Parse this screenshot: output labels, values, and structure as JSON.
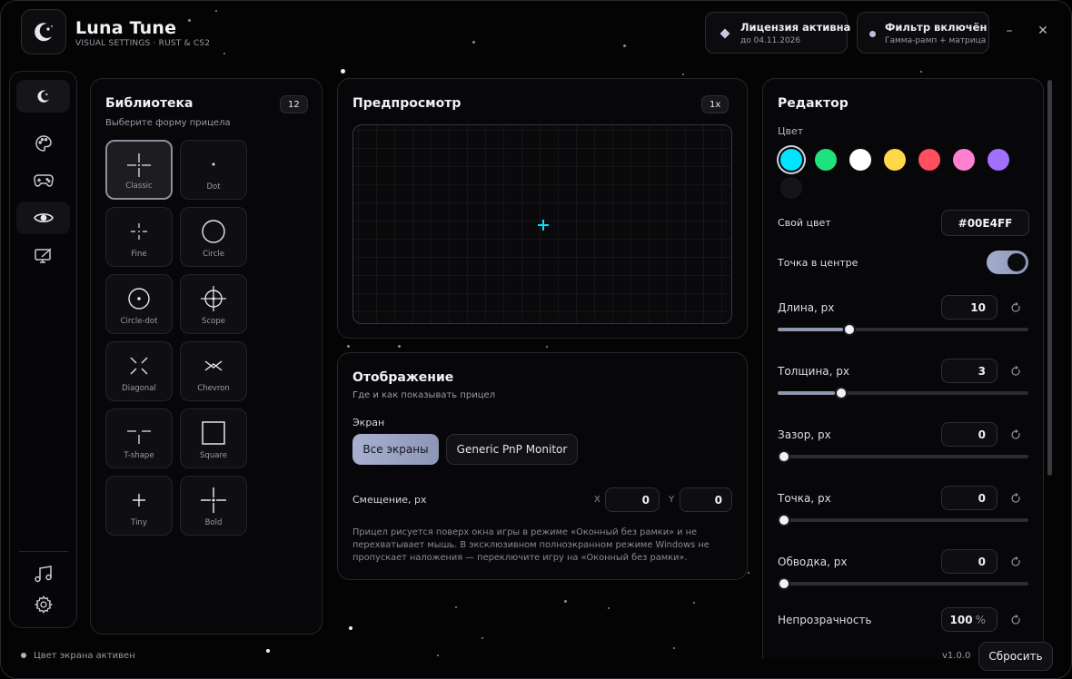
{
  "app": {
    "title": "Luna Tune",
    "subtitle": "VISUAL SETTINGS · RUST & CS2",
    "logo_icon": "moon-star-icon"
  },
  "header": {
    "license": {
      "title": "Лицензия активна",
      "subtitle": "до 04.11.2026",
      "icon": "diamond-icon"
    },
    "filter": {
      "title": "Фильтр включён",
      "subtitle": "Гамма-рамп + матрица",
      "icon": "dot-icon"
    },
    "minimize_label": "–",
    "close_label": "✕"
  },
  "sidebar": {
    "items": [
      {
        "name": "home",
        "icon": "moon-star-icon",
        "active": false
      },
      {
        "name": "palette",
        "icon": "palette-icon",
        "active": false
      },
      {
        "name": "gamepad",
        "icon": "gamepad-icon",
        "active": false
      },
      {
        "name": "eye",
        "icon": "eye-icon",
        "active": true
      },
      {
        "name": "display",
        "icon": "monitor-icon",
        "active": false
      },
      {
        "name": "music",
        "icon": "music-icon",
        "active": false
      },
      {
        "name": "settings",
        "icon": "gear-icon",
        "active": false
      }
    ]
  },
  "library": {
    "title": "Библиотека",
    "subtitle": "Выберите форму прицела",
    "count": "12",
    "items": [
      {
        "label": "Classic",
        "selected": true
      },
      {
        "label": "Dot",
        "selected": false
      },
      {
        "label": "Fine",
        "selected": false
      },
      {
        "label": "Circle",
        "selected": false
      },
      {
        "label": "Circle-dot",
        "selected": false
      },
      {
        "label": "Scope",
        "selected": false
      },
      {
        "label": "Diagonal",
        "selected": false
      },
      {
        "label": "Chevron",
        "selected": false
      },
      {
        "label": "T-shape",
        "selected": false
      },
      {
        "label": "Square",
        "selected": false
      },
      {
        "label": "Tiny",
        "selected": false
      },
      {
        "label": "Bold",
        "selected": false
      }
    ]
  },
  "preview": {
    "title": "Предпросмотр",
    "zoom": "1x",
    "crosshair_color": "#00E4FF"
  },
  "display": {
    "title": "Отображение",
    "subtitle": "Где и как показывать прицел",
    "screen_label": "Экран",
    "screens": [
      "Все экраны",
      "Generic PnP Monitor"
    ],
    "offset_label": "Смещение, px",
    "x_label": "X",
    "x_value": "0",
    "y_label": "Y",
    "y_value": "0",
    "note": "Прицел рисуется поверх окна игры в режиме «Оконный без рамки» и не перехватывает мышь. В эксклюзивном полноэкранном режиме Windows не пропускает наложения — переключите игру на «Оконный без рамки»."
  },
  "editor": {
    "title": "Редактор",
    "color_label": "Цвет",
    "colors": [
      "#00E4FF",
      "#1FE27E",
      "#FFFFFF",
      "#FFD84A",
      "#FF4F5E",
      "#FF7FD0",
      "#A170FF",
      "#151518"
    ],
    "selected_color": "#00E4FF",
    "custom_color_label": "Свой цвет",
    "custom_color_value": "#00E4FF",
    "center_dot_label": "Точка в центре",
    "center_dot_on": true,
    "sliders": [
      {
        "label": "Длина, px",
        "value": "10",
        "fraction": 0.26
      },
      {
        "label": "Толщина, px",
        "value": "3",
        "fraction": 0.23
      },
      {
        "label": "Зазор, px",
        "value": "0",
        "fraction": 0.0
      },
      {
        "label": "Точка, px",
        "value": "0",
        "fraction": 0.0
      },
      {
        "label": "Обводка, px",
        "value": "0",
        "fraction": 0.0
      }
    ],
    "opacity_label": "Непрозрачность",
    "opacity_value": "100",
    "opacity_unit": "%"
  },
  "footer": {
    "status": "Цвет экрана активен",
    "version": "v1.0.0",
    "reset_label": "Сбросить"
  }
}
